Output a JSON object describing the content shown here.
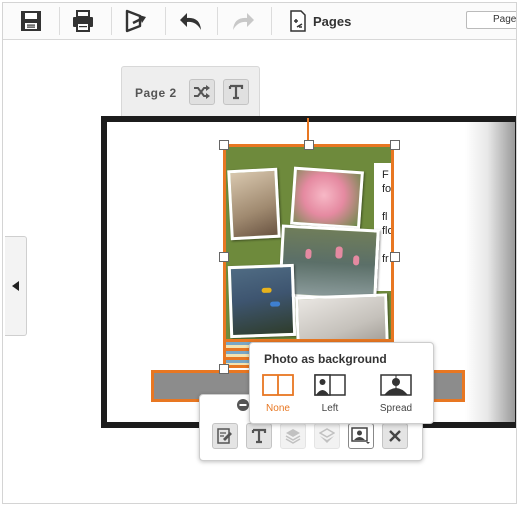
{
  "toolbar": {
    "icons": [
      "save-icon",
      "print-icon",
      "share-icon",
      "undo-icon",
      "redo-icon",
      "pages-icon"
    ],
    "pages_label": "Pages",
    "pages_select_value": "Page"
  },
  "page_tab": {
    "label": "Page 2",
    "icons": [
      "shuffle-icon",
      "text-icon"
    ]
  },
  "text_card": {
    "lines": [
      "F",
      "fo",
      "",
      "fl",
      "flo",
      "",
      "fr"
    ]
  },
  "photo_popup": {
    "title": "Photo as background",
    "options": [
      {
        "label": "None",
        "selected": true
      },
      {
        "label": "Left",
        "selected": false
      },
      {
        "label": "Spread",
        "selected": false
      }
    ]
  },
  "bottom_bar": {
    "icons": [
      "edit-photo-icon",
      "text-icon",
      "bring-forward-icon",
      "send-backward-icon",
      "photo-background-icon",
      "delete-icon"
    ],
    "disabled": [
      "bring-forward-icon",
      "send-backward-icon"
    ]
  },
  "colors": {
    "accent": "#e87722",
    "book_border": "#1c1c1c",
    "stripe": "#8c8c8c"
  }
}
